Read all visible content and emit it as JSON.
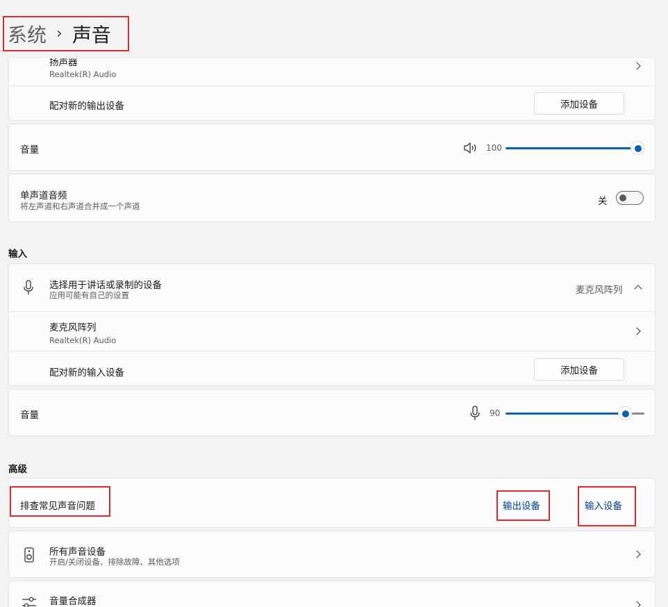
{
  "breadcrumb": {
    "parent": "系统",
    "separator": "›",
    "current": "声音"
  },
  "output": {
    "speaker": {
      "name": "扬声器",
      "detail": "Realtek(R) Audio"
    },
    "pair": {
      "label": "配对新的输出设备",
      "button": "添加设备"
    },
    "volume": {
      "label": "音量",
      "value": "100",
      "level": 1.0
    },
    "mono": {
      "title": "单声道音频",
      "desc": "将左声道和右声道合并成一个声道",
      "state": "关"
    }
  },
  "input": {
    "section": "输入",
    "select": {
      "title": "选择用于讲话或录制的设备",
      "desc": "应用可能有自己的设置",
      "selected": "麦克风阵列"
    },
    "mic": {
      "name": "麦克风阵列",
      "detail": "Realtek(R) Audio"
    },
    "pair": {
      "label": "配对新的输入设备",
      "button": "添加设备"
    },
    "volume": {
      "label": "音量",
      "value": "90",
      "level": 0.9
    }
  },
  "advanced": {
    "section": "高级",
    "troubleshoot": {
      "label": "排查常见声音问题",
      "output_link": "输出设备",
      "input_link": "输入设备"
    },
    "all_devices": {
      "title": "所有声音设备",
      "desc": "开启/关闭设备、排除故障、其他选项"
    },
    "mixer": {
      "title": "音量合成器"
    }
  },
  "colors": {
    "accent": "#0a5fb4",
    "link": "#003e92",
    "highlight": "#d92b2b"
  }
}
